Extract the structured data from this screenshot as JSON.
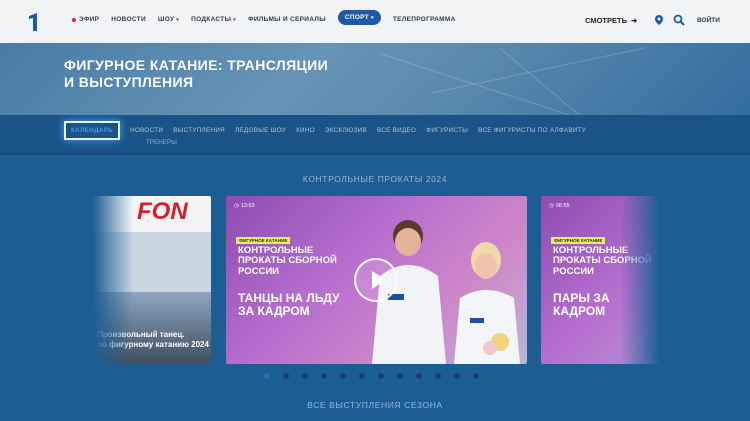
{
  "header": {
    "nav": [
      {
        "label": "ЭФИР",
        "live": true
      },
      {
        "label": "НОВОСТИ"
      },
      {
        "label": "ШОУ",
        "caret": true
      },
      {
        "label": "ПОДКАСТЫ",
        "caret": true
      },
      {
        "label": "ФИЛЬМЫ И СЕРИАЛЫ"
      },
      {
        "label": "СПОРТ",
        "caret": true,
        "active": true
      },
      {
        "label": "ТЕЛЕПРОГРАММА"
      }
    ],
    "watch_label": "СМОТРЕТЬ",
    "watch_arrow": "➜",
    "login_label": "ВОЙТИ"
  },
  "hero": {
    "title_line1": "ФИГУРНОЕ КАТАНИЕ: ТРАНСЛЯЦИИ",
    "title_line2": "И ВЫСТУПЛЕНИЯ"
  },
  "tabs": {
    "items": [
      "КАЛЕНДАРЬ",
      "НОВОСТИ",
      "ВЫСТУПЛЕНИЯ",
      "ЛЕДОВЫЕ ШОУ",
      "КИНО",
      "ЭКСКЛЮЗИВ",
      "ВСЕ ВИДЕО",
      "ФИГУРИСТЫ",
      "ВСЕ ФИГУРИСТЫ ПО АЛФАВИТУ"
    ],
    "second_row": "ТРЕНЕРЫ",
    "selected": "КАЛЕНДАРЬ"
  },
  "sections": {
    "carousel_title": "КОНТРОЛЬНЫЕ ПРОКАТЫ 2024",
    "bottom_title": "ВСЕ ВЫСТУПЛЕНИЯ СЕЗОНА"
  },
  "cards": {
    "left": {
      "banner": "FON",
      "caption_line1": "Произвольный танец.",
      "caption_line2": "по фигурному катанию 2024"
    },
    "main": {
      "time": "13:03",
      "tag": "ФИГУРНОЕ КАТАНИЕ",
      "subtitle": "КОНТРОЛЬНЫЕ ПРОКАТЫ СБОРНОЙ РОССИИ",
      "title": "ТАНЦЫ НА ЛЬДУ ЗА КАДРОМ"
    },
    "right": {
      "time": "06:55",
      "tag": "ФИГУРНОЕ КАТАНИЕ",
      "subtitle": "КОНТРОЛЬНЫЕ ПРОКАТЫ СБОРНОЙ РОССИИ",
      "title": "ПАРЫ ЗА КАДРОМ"
    }
  },
  "carousel": {
    "dot_count": 12,
    "active_dot": 0
  },
  "colors": {
    "accent": "#1d5aa6",
    "live": "#e0242a",
    "tag": "#e7ef5a",
    "page_bg": "#1c5d93"
  }
}
